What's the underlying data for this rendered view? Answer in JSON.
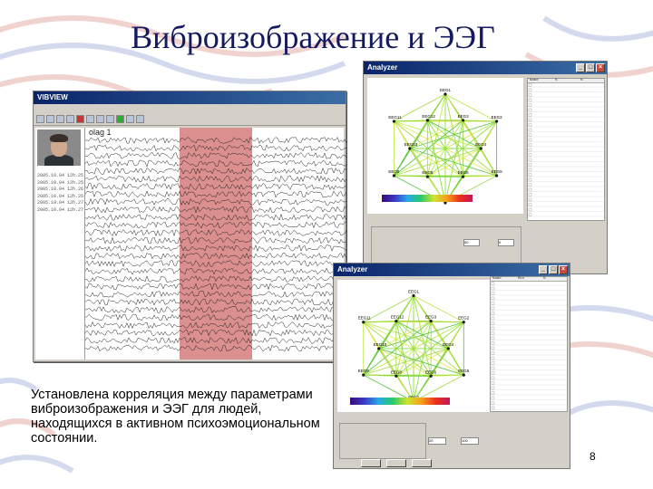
{
  "slide": {
    "title": "Виброизображение и ЭЭГ",
    "caption": "Установлена корреляция между параметрами виброизображения и ЭЭГ для людей, находящихся в активном психоэмоциональном состоянии.",
    "page_number": "8"
  },
  "eeg_window": {
    "title": "VIBVIEW",
    "tab_label": "olag 1",
    "timestamps": [
      "2005.10.04 12h.25:06",
      "2005.10.04 12h.25:36",
      "2005.10.04 12h.26:06",
      "2005.10.04 12h.26:36",
      "2005.10.04 12h.27:06",
      "2005.10.04 12h.27:36"
    ],
    "highlight_color": "#cf6a6a"
  },
  "analyzer_1": {
    "title": "Analyzer",
    "node_labels": [
      "EEG1",
      "EEG3",
      "EEG2",
      "EEG4",
      "EEG5",
      "EEG6",
      "EEG7",
      "EEG8",
      "EEG9",
      "EEG10",
      "EEG11",
      "EEG12"
    ],
    "table_headers": [
      "Name",
      "%",
      "%"
    ],
    "field_values": [
      "50",
      "0"
    ]
  },
  "analyzer_2": {
    "title": "Analyzer",
    "node_labels": [
      "EEG1",
      "EEG3",
      "EEG2",
      "EEG4",
      "EEG5",
      "EEG6",
      "EEG7",
      "EEG8",
      "EEG9",
      "EEG10",
      "EEG11",
      "EEG12"
    ],
    "table_headers": [
      "Name",
      "Min",
      "%"
    ],
    "field_values": [
      "20",
      "100"
    ]
  }
}
